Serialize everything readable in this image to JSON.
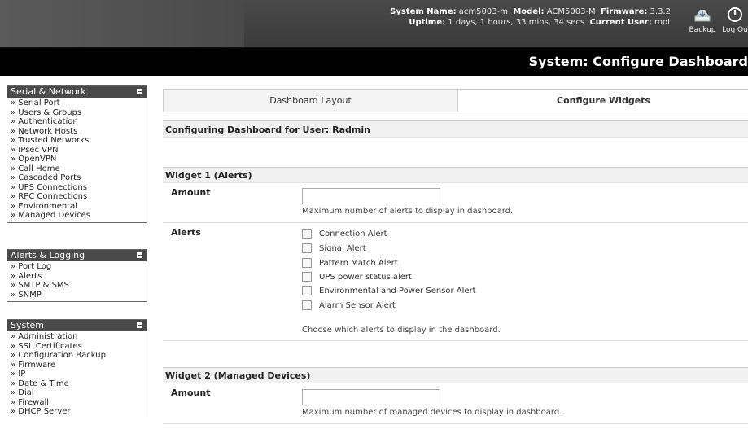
{
  "header": {
    "system_name_label": "System Name:",
    "system_name": "acm5003-m",
    "model_label": "Model:",
    "model": "ACM5003-M",
    "firmware_label": "Firmware:",
    "firmware": "3.3.2",
    "uptime_label": "Uptime:",
    "uptime": "1 days, 1 hours, 33 mins, 34 secs",
    "user_label": "Current User:",
    "user": "root",
    "backup_label": "Backup",
    "logout_label": "Log Ou",
    "page_title": "System: Configure Dashboard"
  },
  "sidebar": {
    "serial_network": {
      "title": "Serial & Network",
      "items": [
        "» Serial Port",
        "» Users & Groups",
        "» Authentication",
        "» Network Hosts",
        "» Trusted Networks",
        "» IPsec VPN",
        "» OpenVPN",
        "» Call Home",
        "» Cascaded Ports",
        "» UPS Connections",
        "» RPC Connections",
        "» Environmental",
        "» Managed Devices"
      ]
    },
    "alerts_logging": {
      "title": "Alerts & Logging",
      "items": [
        "» Port Log",
        "» Alerts",
        "» SMTP & SMS",
        "» SNMP"
      ]
    },
    "system": {
      "title": "System",
      "items": [
        "» Administration",
        "» SSL Certificates",
        "» Configuration Backup",
        "» Firmware",
        "» IP",
        "» Date & Time",
        "» Dial",
        "» Firewall",
        "» DHCP Server"
      ]
    }
  },
  "tabs": {
    "layout": "Dashboard Layout",
    "widgets": "Configure Widgets"
  },
  "main": {
    "configuring_title": "Configuring Dashboard for User: Radmin",
    "widget1": {
      "title": "Widget 1 (Alerts)",
      "amount_label": "Amount",
      "amount_value": "",
      "amount_hint": "Maximum number of alerts to display in dashboard.",
      "alerts_label": "Alerts",
      "options": [
        "Connection Alert",
        "Signal Alert",
        "Pattern Match Alert",
        "UPS power status alert",
        "Environmental and Power Sensor Alert",
        "Alarm Sensor Alert"
      ],
      "alerts_hint": "Choose which alerts to display in the dashboard."
    },
    "widget2": {
      "title": "Widget 2 (Managed Devices)",
      "amount_label": "Amount",
      "amount_value": "",
      "amount_hint": "Maximum number of managed devices to display in dashboard."
    }
  }
}
